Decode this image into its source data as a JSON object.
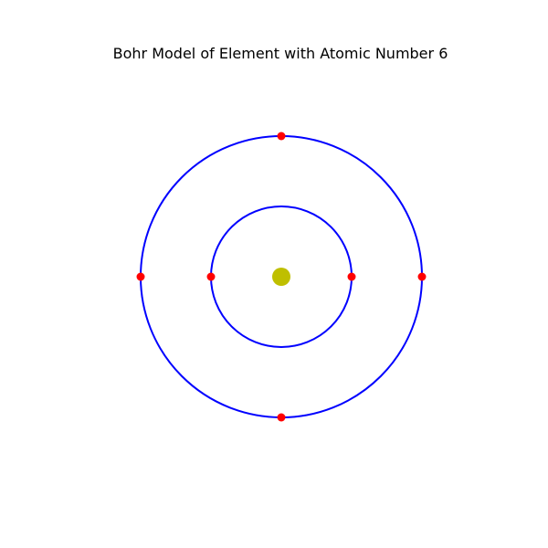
{
  "figure": {
    "title": "Bohr Model of Element with Atomic Number 6"
  },
  "diagram": {
    "atomic_number": 6,
    "nucleus_color": "#bfbf00",
    "orbit_color": "#0000ff",
    "electron_color": "#ff0000",
    "shells": [
      {
        "shell": 1,
        "electrons": 2
      },
      {
        "shell": 2,
        "electrons": 4
      }
    ]
  }
}
